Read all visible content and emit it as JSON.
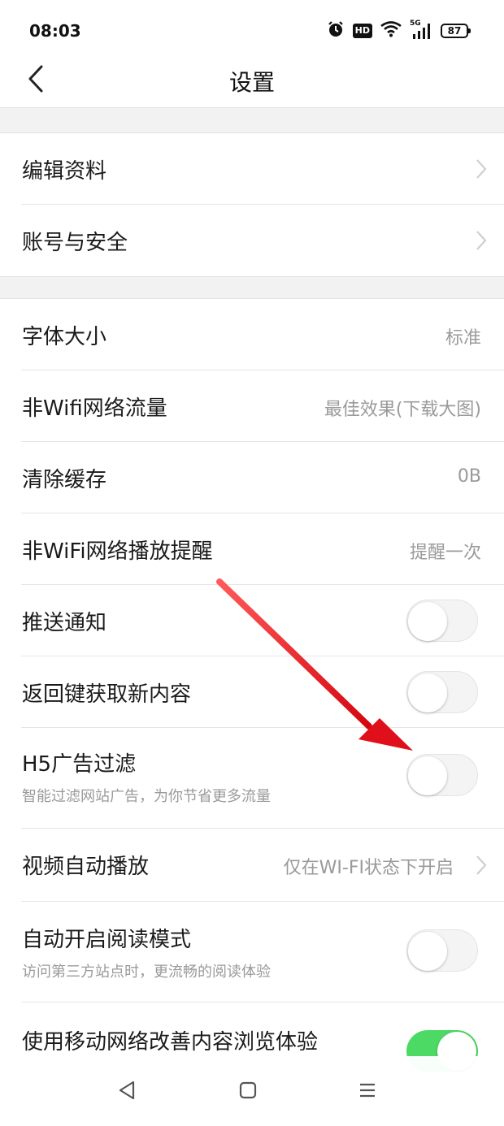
{
  "status_bar": {
    "time": "08:03",
    "hd_label": "HD",
    "network_label": "5G",
    "battery_level": "87",
    "icons": [
      "alarm-icon",
      "hd-icon",
      "wifi-icon",
      "signal-5g-icon",
      "battery-icon"
    ]
  },
  "header": {
    "title": "设置",
    "back_icon": "chevron-left-icon"
  },
  "settings": {
    "edit_profile": {
      "label": "编辑资料"
    },
    "account_security": {
      "label": "账号与安全"
    },
    "font_size": {
      "label": "字体大小",
      "value": "标准"
    },
    "non_wifi_traffic": {
      "label": "非Wifi网络流量",
      "value": "最佳效果(下载大图)"
    },
    "clear_cache": {
      "label": "清除缓存",
      "value": "0B"
    },
    "non_wifi_play_reminder": {
      "label": "非WiFi网络播放提醒",
      "value": "提醒一次"
    },
    "push_notifications": {
      "label": "推送通知",
      "enabled": false
    },
    "back_key_refresh": {
      "label": "返回键获取新内容",
      "enabled": false
    },
    "h5_ad_filter": {
      "label": "H5广告过滤",
      "description": "智能过滤网站广告，为你节省更多流量",
      "enabled": false
    },
    "video_autoplay": {
      "label": "视频自动播放",
      "value": "仅在WI-FI状态下开启"
    },
    "auto_reader_mode": {
      "label": "自动开启阅读模式",
      "description": "访问第三方站点时，更流畅的阅读体验",
      "enabled": false
    },
    "mobile_network_improve": {
      "label": "使用移动网络改善内容浏览体验",
      "enabled": true
    }
  },
  "nav_bar": {
    "icons": [
      "back-triangle-icon",
      "home-square-icon",
      "menu-lines-icon"
    ]
  },
  "colors": {
    "toggle_on": "#4cd964",
    "toggle_off": "#f4f4f4",
    "secondary_text": "#9a9a9a",
    "section_gap": "#f2f2f2",
    "annotation_arrow": "#e8141b"
  }
}
